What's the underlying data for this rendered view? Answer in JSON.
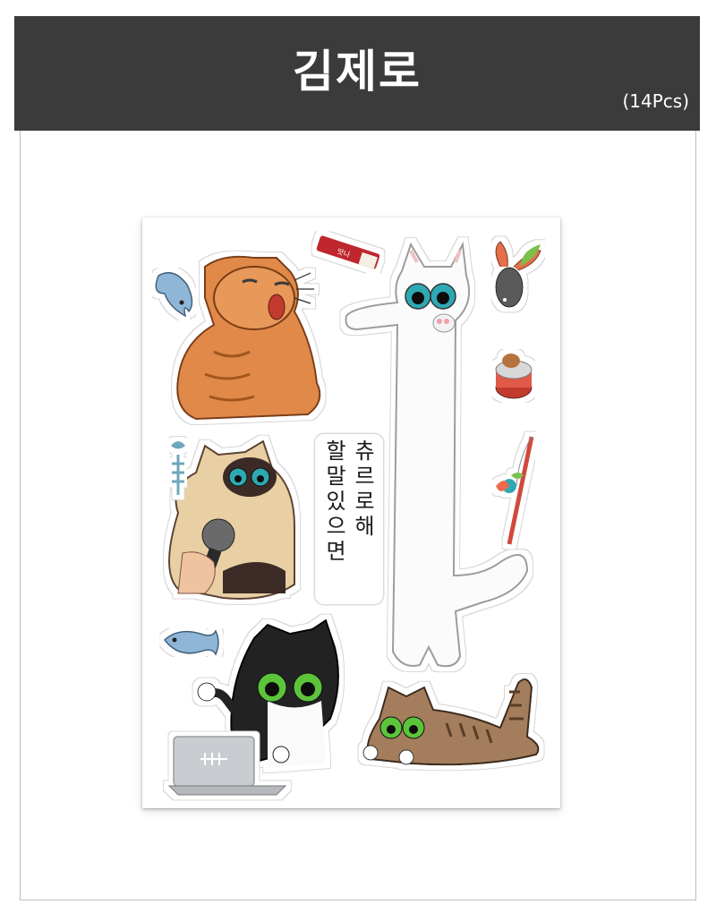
{
  "header": {
    "title": "김제로",
    "count": "(14Pcs)"
  },
  "sticker_sheet": {
    "text_sticker": {
      "line1": "츄르로해",
      "line2": "할말있으면"
    },
    "snack_label": "맛나"
  },
  "colors": {
    "header_bg": "#3b3b3b",
    "header_text": "#ffffff",
    "frame_border": "#bdbdbd",
    "orange_cat": "#e0894a",
    "siamese_body": "#e8cfa4",
    "siamese_face": "#3a2c26",
    "tuxedo": "#222222",
    "tabby": "#a47e5c",
    "long_cat": "#ffffff",
    "eye_teal": "#2fa9b3",
    "eye_green": "#5cc43a",
    "fish_blue": "#8fb6d6"
  },
  "icons": {
    "fish": "fish-icon",
    "fishbone": "fishbone-icon",
    "snack": "snack-stick-icon",
    "toy_mouse": "toy-mouse-icon",
    "cat_can": "cat-food-can-icon",
    "fishing_rod": "cat-teaser-rod-icon",
    "microphone": "microphone-icon",
    "laptop": "laptop-icon"
  }
}
